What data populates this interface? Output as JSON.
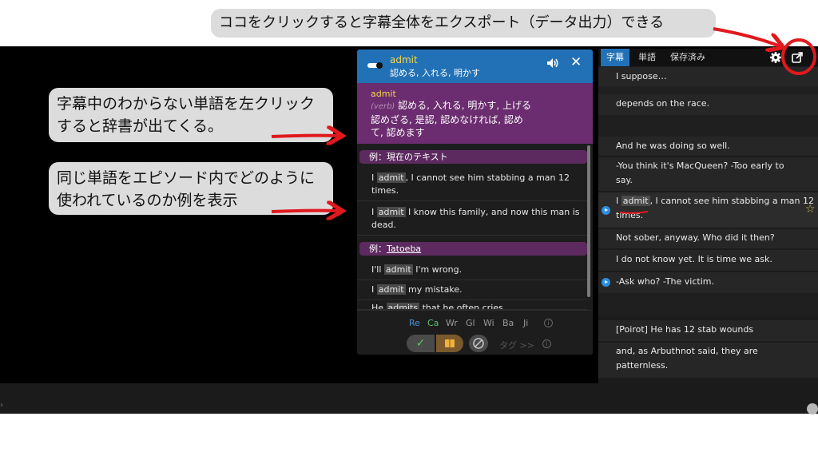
{
  "annotations": {
    "top": "ココをクリックすると字幕全体をエクスポート（データ出力）できる",
    "left1_line1": "字幕中のわからない単語を左クリック",
    "left1_line2": "すると辞書が出てくる。",
    "left2_line1": "同じ単語をエピソード内でどのように",
    "left2_line2": "使われているのか例を表示"
  },
  "dictionary": {
    "word": "admit",
    "gloss": "認める, 入れる, 明かす",
    "def_word": "admit",
    "def_pos": "(verb)",
    "def_line1": "認める, 入れる, 明かす, 上げる",
    "def_line2": "認めざる, 是認, 認めなければ, 認め",
    "def_line3": "て, 認めます",
    "section1": "例：現在のテキスト",
    "section2_prefix": "例：",
    "section2_link": "Tatoeba",
    "examples_current": [
      {
        "pre": "I ",
        "hl": "admit",
        "post": ", I cannot see him stabbing a man 12",
        "line2": "times."
      },
      {
        "pre": "I ",
        "hl": "admit",
        "post": " I know this family, and now this man is",
        "line2": "dead."
      }
    ],
    "examples_tatoeba": [
      {
        "pre": "I'll ",
        "hl": "admit",
        "post": " I'm wrong."
      },
      {
        "pre": "I ",
        "hl": "admit",
        "post": " my mistake."
      },
      {
        "pre": "He ",
        "hl": "admits",
        "post": " that he often cries"
      }
    ],
    "sources": [
      "Re",
      "Ca",
      "Wr",
      "Gl",
      "Wi",
      "Ba",
      "Ji"
    ],
    "source_colors": [
      "#4a90d9",
      "#5ec26a",
      "#9a9a9a",
      "#9a9a9a",
      "#9a9a9a",
      "#9a9a9a",
      "#9a9a9a"
    ],
    "tag_label": "タグ >>"
  },
  "panel": {
    "tabs": [
      "字幕",
      "単語",
      "保存済み"
    ],
    "subtitles": [
      {
        "line1": "I suppose…",
        "line2": ""
      },
      {
        "line1": "depends on the race.",
        "line2": ""
      },
      {
        "line1": "",
        "line2": ""
      },
      {
        "line1": "And he was doing so well.",
        "line2": ""
      },
      {
        "line1": "-You think it's MacQueen? -Too early to",
        "line2": "say."
      },
      {
        "line1_pre": "I ",
        "line1_hl": "admit",
        "line1_post": ", I cannot see him stabbing a man 12",
        "line2": "times."
      },
      {
        "line1": "Not sober, anyway. Who did it then?",
        "line2": ""
      },
      {
        "line1": "I do not know yet. It is time we ask.",
        "line2": ""
      },
      {
        "line1": "-Ask who? -The victim.",
        "line2": ""
      },
      {
        "line1": "[Poirot] He has 12 stab wounds",
        "line2": ""
      },
      {
        "line1": "and, as Arbuthnot said, they are",
        "line2": "patternless."
      }
    ]
  },
  "colors": {
    "accent_blue": "#2270b5",
    "purple": "#6b2d6f",
    "highlight_red": "#e0191f",
    "word_yellow": "#f5d94b"
  }
}
